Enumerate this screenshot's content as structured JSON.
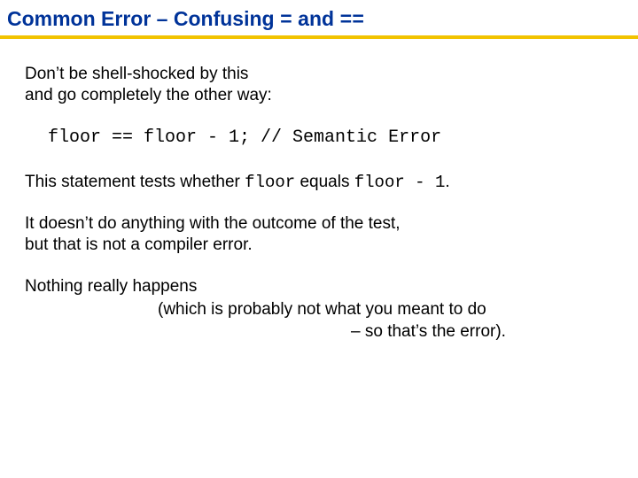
{
  "header": {
    "title_prefix": "Common Error – Confusing ",
    "op1": "=",
    "and": " and ",
    "op2": "=="
  },
  "body": {
    "p1_l1": "Don’t be shell-shocked by this",
    "p1_l2": "and go completely the other way:",
    "code": "floor == floor - 1; // Semantic Error",
    "p2_a": "This statement tests whether ",
    "p2_c1": "floor",
    "p2_b": " equals ",
    "p2_c2": "floor - 1",
    "p2_c": ".",
    "p3_l1": "It doesn’t do anything with the outcome of the test,",
    "p3_l2": "but that is not a compiler error.",
    "p4_l1": "Nothing really happens",
    "p4_l2": "(which is probably not what you meant to do",
    "p4_l3": "– so that’s the error)."
  }
}
